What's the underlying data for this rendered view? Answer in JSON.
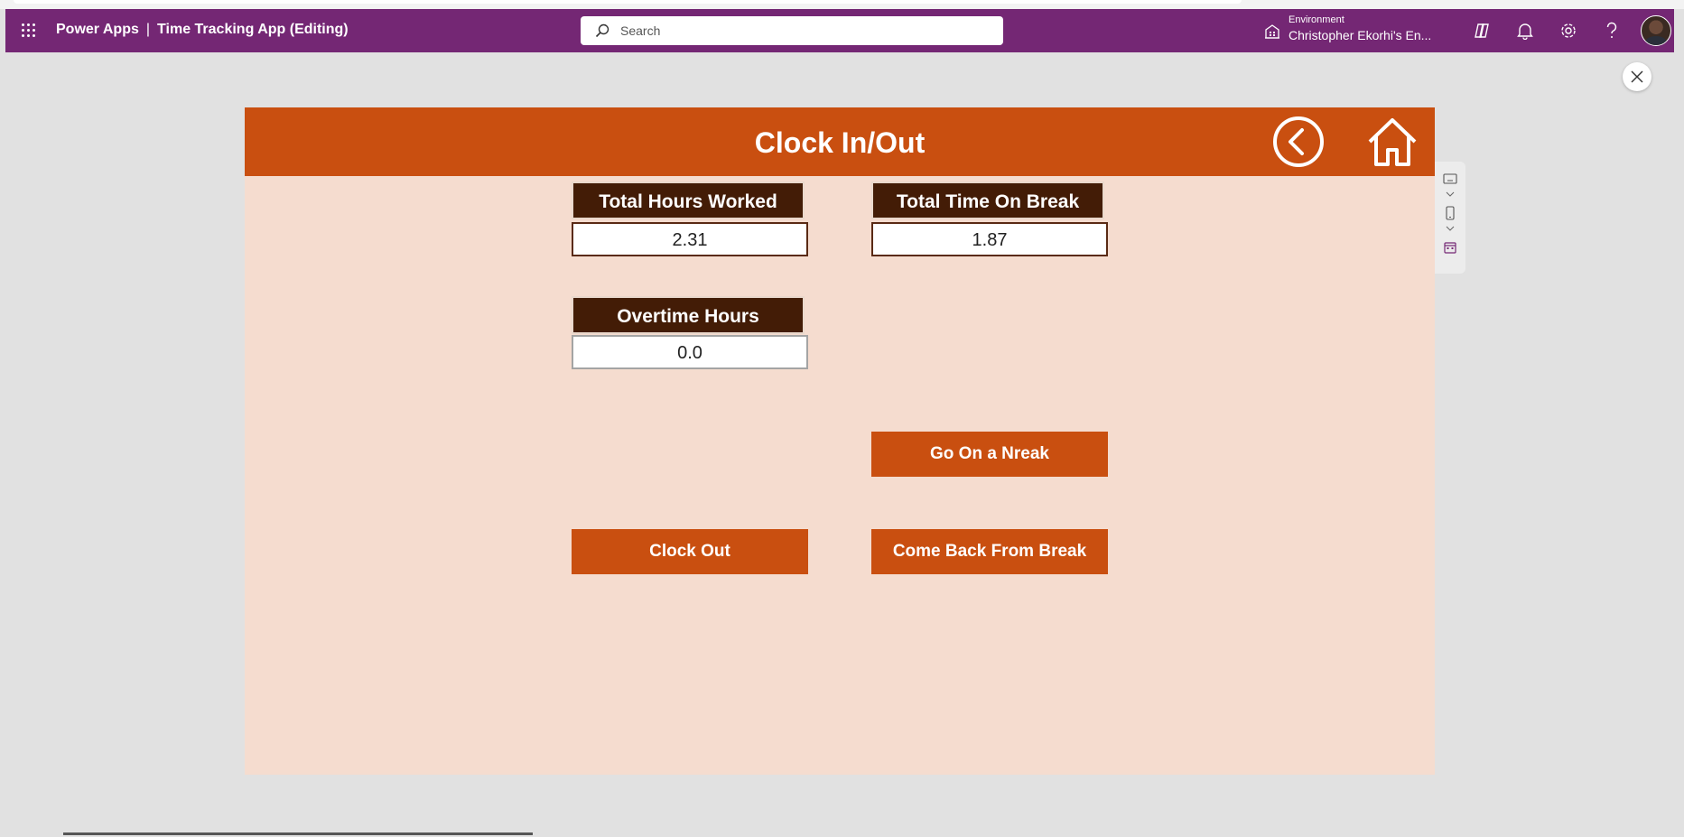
{
  "header": {
    "product_name": "Power Apps",
    "separator": "|",
    "app_title": "Time Tracking App (Editing)",
    "search_placeholder": "Search",
    "environment_label": "Environment",
    "environment_name": "Christopher Ekorhi's En...",
    "icons": [
      "app-launcher-icon",
      "search-icon",
      "environment-icon",
      "copilot-icon",
      "bell-icon",
      "gear-icon",
      "help-icon",
      "avatar"
    ]
  },
  "screen": {
    "title": "Clock In/Out",
    "nav_icons": [
      "back-arrow-icon",
      "home-icon"
    ],
    "fields": [
      {
        "label": "Total Hours Worked",
        "value": "2.31"
      },
      {
        "label": "Total Time On Break",
        "value": "1.87"
      },
      {
        "label": "Overtime Hours",
        "value": "0.0"
      }
    ],
    "buttons": {
      "go_on_break": "Go On a Nreak",
      "clock_out": "Clock Out",
      "come_back": "Come Back From Break"
    }
  },
  "colors": {
    "header_purple": "#742774",
    "banner_orange": "#c94f10",
    "label_brown": "#431c06",
    "canvas_peach": "#f5dccf"
  }
}
